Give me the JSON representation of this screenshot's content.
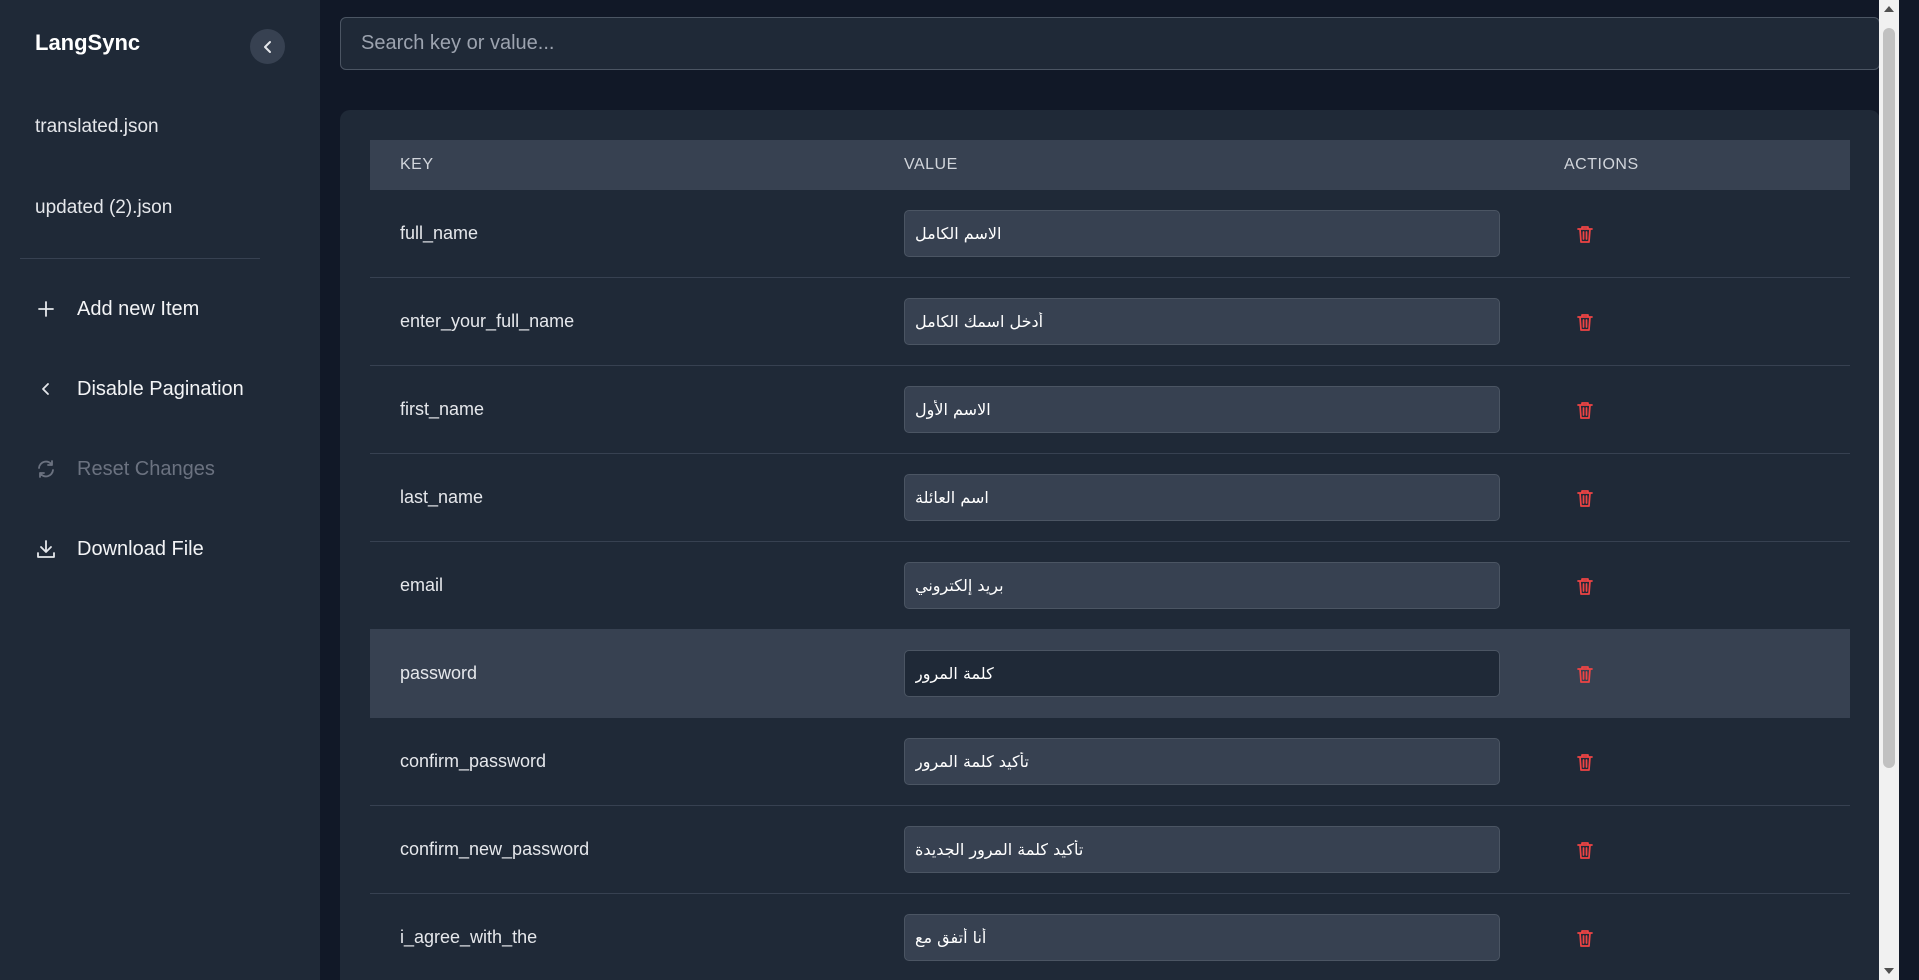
{
  "sidebar": {
    "brand": "LangSync",
    "files": [
      {
        "label": "translated.json"
      },
      {
        "label": "updated (2).json"
      }
    ],
    "actions": {
      "add": "Add new Item",
      "pagination": "Disable Pagination",
      "reset": "Reset Changes",
      "download": "Download File"
    }
  },
  "search": {
    "placeholder": "Search key or value...",
    "value": ""
  },
  "table": {
    "headers": {
      "key": "KEY",
      "value": "VALUE",
      "actions": "ACTIONS"
    },
    "rows": [
      {
        "key": "full_name",
        "value": "الاسم الكامل"
      },
      {
        "key": "enter_your_full_name",
        "value": "أدخل اسمك الكامل"
      },
      {
        "key": "first_name",
        "value": "الاسم الأول"
      },
      {
        "key": "last_name",
        "value": "اسم العائلة"
      },
      {
        "key": "email",
        "value": "بريد إلكتروني"
      },
      {
        "key": "password",
        "value": "كلمة المرور"
      },
      {
        "key": "confirm_password",
        "value": "تأكيد كلمة المرور"
      },
      {
        "key": "confirm_new_password",
        "value": "تأكيد كلمة المرور الجديدة"
      },
      {
        "key": "i_agree_with_the",
        "value": "أنا أتفق مع"
      }
    ]
  },
  "colors": {
    "sidebar_bg": "#1f2937",
    "main_bg": "#111827",
    "header_bg": "#374151",
    "delete_red": "#ef4444"
  }
}
